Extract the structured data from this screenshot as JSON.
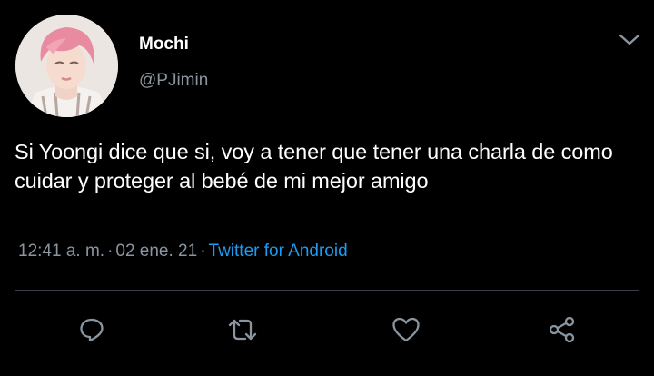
{
  "author": {
    "name": "Mochi",
    "handle": "@PJimin"
  },
  "tweet": {
    "text": "Si Yoongi dice que si, voy a tener que tener una charla de como cuidar y proteger al bebé de mi mejor amigo",
    "time": "12:41 a. m.",
    "date": "02 ene. 21",
    "source": "Twitter for Android",
    "separator": "·"
  },
  "actions": [
    "reply-icon",
    "retweet-icon",
    "like-icon",
    "share-icon"
  ],
  "colors": {
    "background": "#000000",
    "text": "#ffffff",
    "secondary": "#8a95a0",
    "link": "#1d9bf0",
    "icon": "#8a95a0"
  }
}
